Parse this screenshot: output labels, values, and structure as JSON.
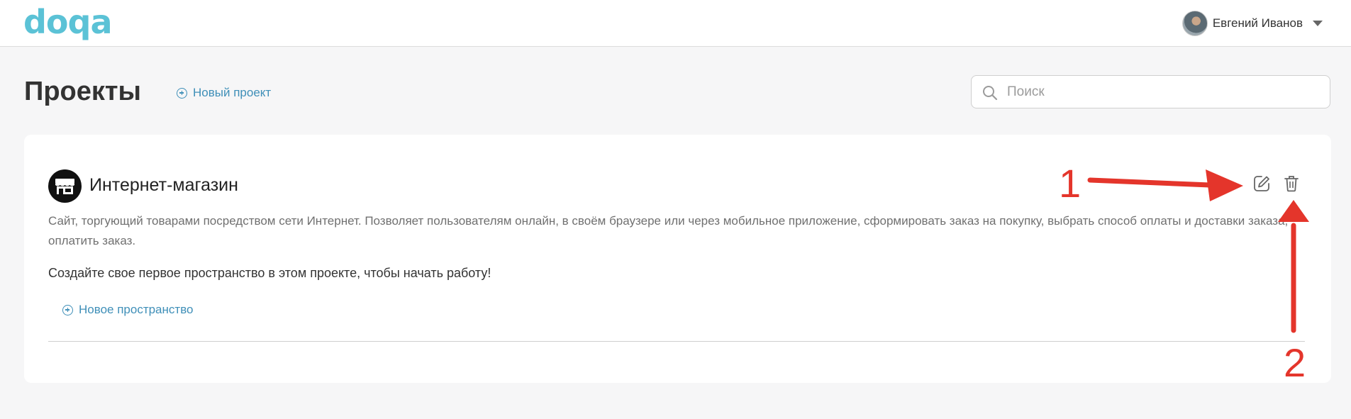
{
  "header": {
    "logo_text": "doqa",
    "user_name": "Евгений Иванов"
  },
  "page": {
    "title": "Проекты",
    "new_project_label": "Новый проект",
    "search_placeholder": "Поиск"
  },
  "project": {
    "title": "Интернет-магазин",
    "description": "Сайт, торгующий товарами посредством сети Интернет. Позволяет пользователям онлайн, в своём браузере или через мобильное приложение, сформировать заказ на покупку, выбрать способ оплаты и доставки заказа, оплатить заказ.",
    "empty_state_text": "Создайте свое первое пространство в этом проекте, чтобы начать работу!",
    "new_space_label": "Новое пространство",
    "icons": {
      "project": "store-icon",
      "edit": "edit-icon",
      "delete": "trash-icon"
    }
  },
  "annotations": {
    "label_1": "1",
    "label_2": "2",
    "color": "#e4352b"
  },
  "colors": {
    "brand": "#5bc2d6",
    "link": "#3f8fb8",
    "background": "#f6f6f7"
  }
}
